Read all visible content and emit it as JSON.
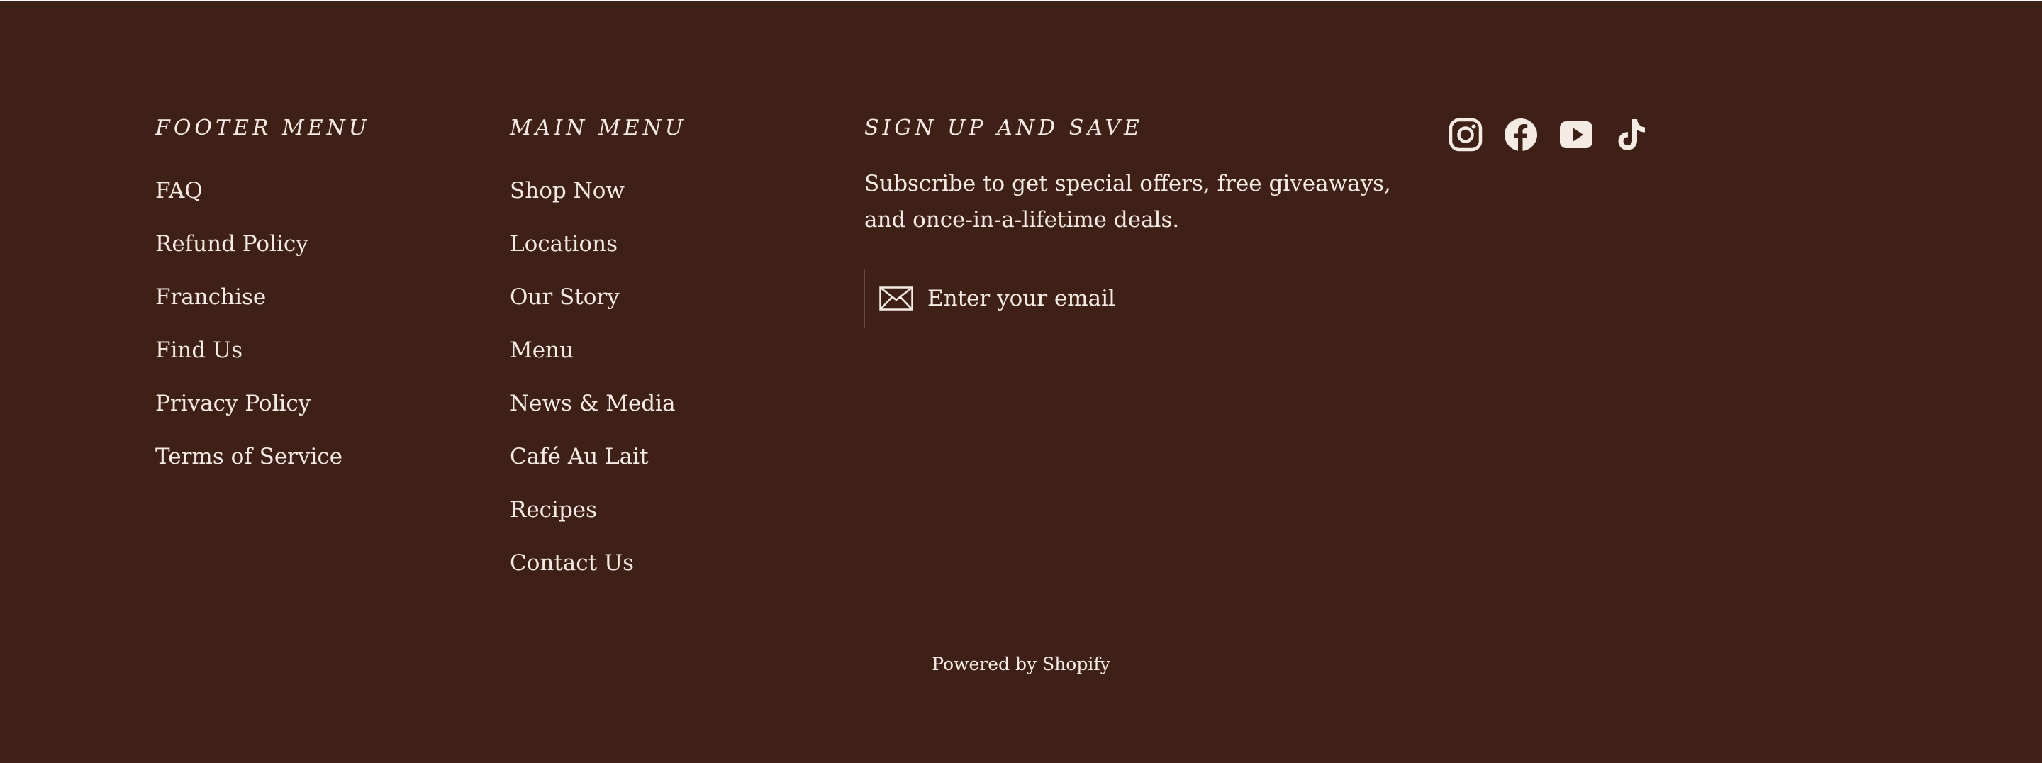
{
  "footer_menu": {
    "heading": "FOOTER MENU",
    "items": [
      "FAQ",
      "Refund Policy",
      "Franchise",
      "Find Us",
      "Privacy Policy",
      "Terms of Service"
    ]
  },
  "main_menu": {
    "heading": "MAIN MENU",
    "items": [
      "Shop Now",
      "Locations",
      "Our Story",
      "Menu",
      "News & Media",
      "Café Au Lait",
      "Recipes",
      "Contact Us"
    ]
  },
  "signup": {
    "heading": "SIGN UP AND SAVE",
    "description": "Subscribe to get special offers, free giveaways, and once-in-a-lifetime deals.",
    "email_placeholder": "Enter your email",
    "icon": "envelope-icon"
  },
  "social": {
    "icons": [
      "instagram-icon",
      "facebook-icon",
      "youtube-icon",
      "tiktok-icon"
    ]
  },
  "powered_by": "Powered by Shopify",
  "colors": {
    "background": "#3f2017",
    "text": "#f4ece4",
    "border": "#6a4a3e"
  }
}
